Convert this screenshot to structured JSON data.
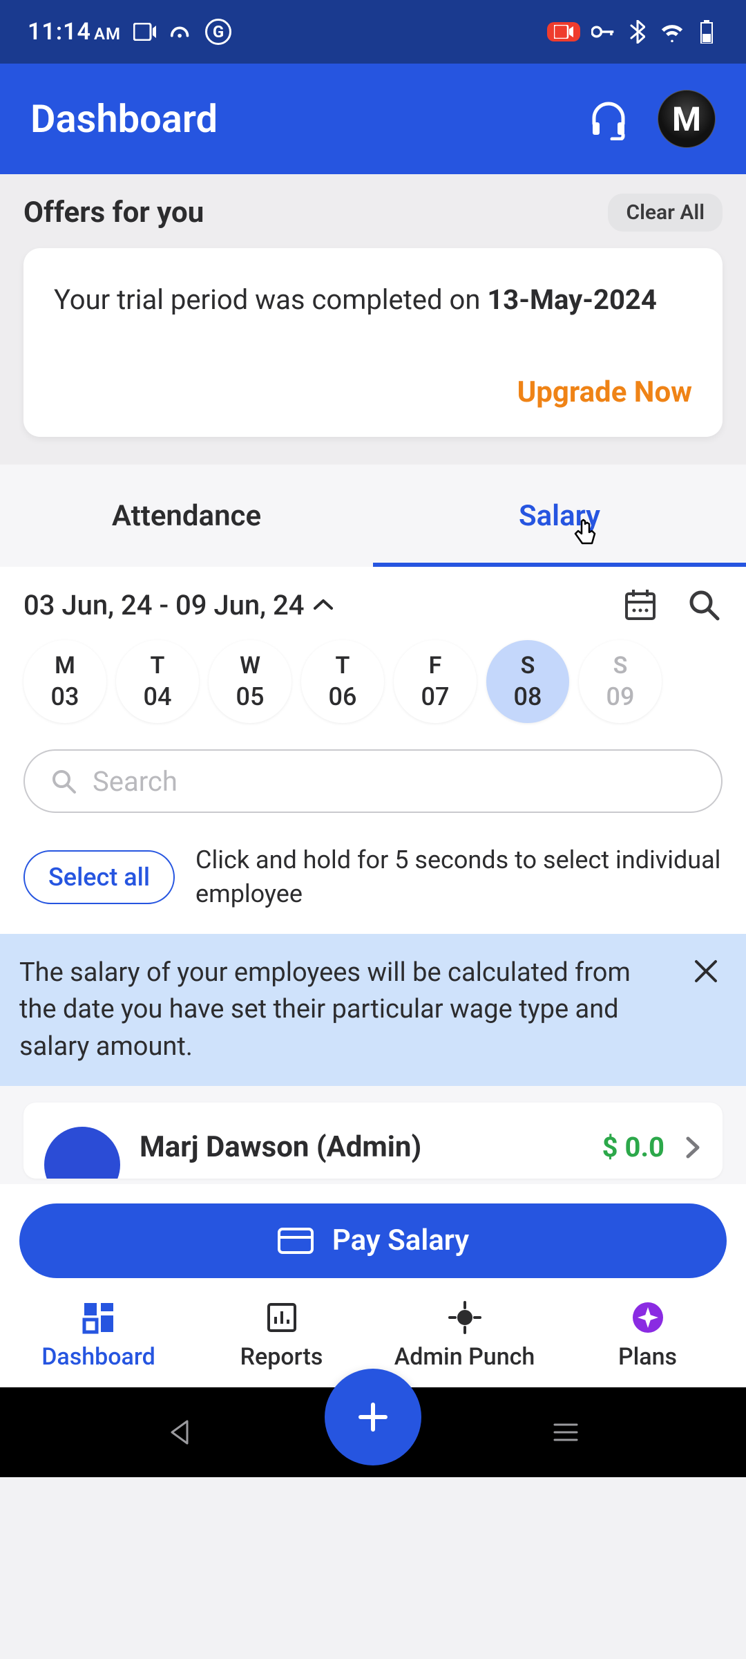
{
  "status": {
    "time": "11:14",
    "ampm": "AM"
  },
  "header": {
    "title": "Dashboard"
  },
  "offers": {
    "title": "Offers for you",
    "clear_all": "Clear All",
    "card_text_before": "Your trial period was completed on ",
    "card_text_date": "13-May-2024",
    "upgrade": "Upgrade Now"
  },
  "tabs": {
    "attendance": "Attendance",
    "salary": "Salary"
  },
  "dates": {
    "range": "03 Jun, 24 - 09 Jun, 24",
    "days": [
      {
        "dow": "M",
        "num": "03",
        "sel": false,
        "dim": false
      },
      {
        "dow": "T",
        "num": "04",
        "sel": false,
        "dim": false
      },
      {
        "dow": "W",
        "num": "05",
        "sel": false,
        "dim": false
      },
      {
        "dow": "T",
        "num": "06",
        "sel": false,
        "dim": false
      },
      {
        "dow": "F",
        "num": "07",
        "sel": false,
        "dim": false
      },
      {
        "dow": "S",
        "num": "08",
        "sel": true,
        "dim": false
      },
      {
        "dow": "S",
        "num": "09",
        "sel": false,
        "dim": true
      }
    ]
  },
  "search": {
    "placeholder": "Search"
  },
  "select": {
    "button": "Select all",
    "hint": "Click and hold for 5 seconds to select individual employee"
  },
  "banner": {
    "text": "The salary of your employees will be calculated from the date you have set their particular wage type and salary amount."
  },
  "employee": {
    "name": "Marj Dawson (Admin)",
    "amount": "$ 0.0"
  },
  "pay": {
    "label": "Pay Salary"
  },
  "bottom_nav": {
    "dashboard": "Dashboard",
    "reports": "Reports",
    "admin_punch": "Admin Punch",
    "plans": "Plans"
  },
  "avatar_letter": "M"
}
